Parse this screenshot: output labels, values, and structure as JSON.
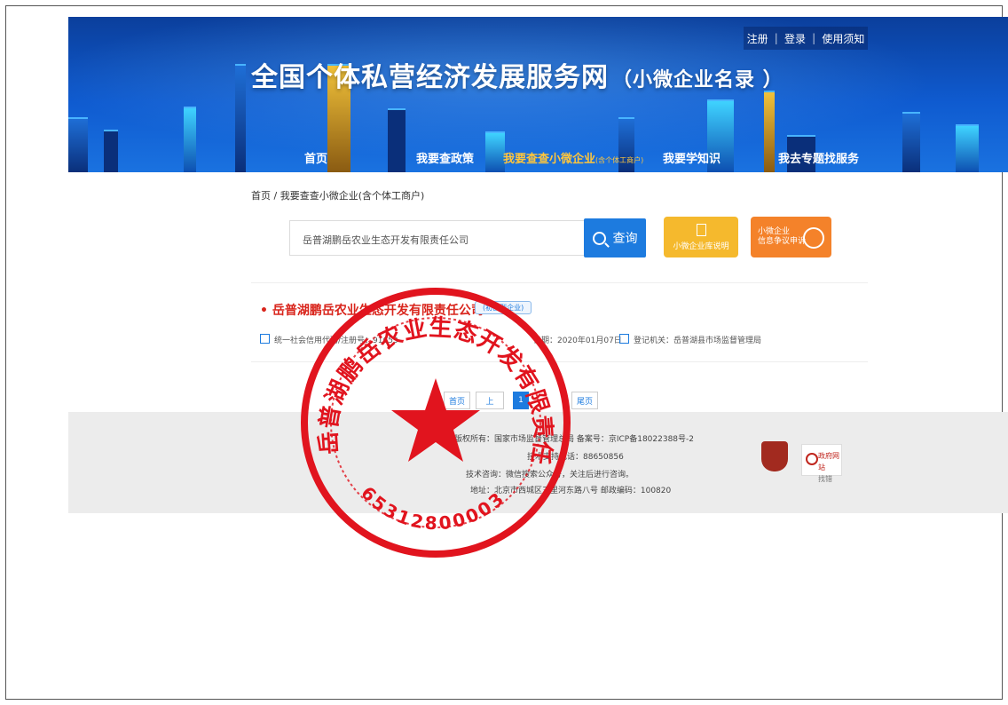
{
  "header": {
    "title": "全国个体私营经济发展服务网",
    "subtitle": "（小微企业名录 ）",
    "top_links": [
      "注册",
      "登录",
      "使用须知"
    ]
  },
  "nav": {
    "items": [
      {
        "label": "首页",
        "small": ""
      },
      {
        "label": "我要查政策",
        "small": ""
      },
      {
        "label": "我要查查小微企业",
        "small": "(含个体工商户)"
      },
      {
        "label": "我要学知识",
        "small": ""
      },
      {
        "label": "我去专题找服务",
        "small": ""
      }
    ],
    "active_index": 2
  },
  "breadcrumb": "首页 / 我要查查小微企业(含个体工商户)",
  "search": {
    "value": "岳普湖鹏岳农业生态开发有限责任公司",
    "button_label": "查询"
  },
  "tiles": {
    "library_label": "小微企业库说明",
    "appeal_line1": "小微企业",
    "appeal_line2": "信息争议申诉"
  },
  "result": {
    "company_name": "岳普湖鹏岳农业生态开发有限责任公司",
    "badge": "(初创型企业)",
    "credit_code": "统一社会信用代码/注册号：91653",
    "date": "日期：2020年01月07日",
    "registration_authority": "登记机关：岳普湖县市场监督管理局"
  },
  "pagination": {
    "first": "首页",
    "prev": "上",
    "current": "1",
    "last": "尾页"
  },
  "footer": {
    "copyright": "版权所有：国家市场监督管理总局 备案号：京ICP备18022388号-2",
    "phone": "技术支持电话：88650856",
    "consult": "技术咨询：微信搜索公众号，关注后进行咨询。",
    "address": "地址：北京市西城区三里河东路八号 邮政编码：100820",
    "gov_site_line1": "政府网站",
    "gov_site_line2": "找错"
  },
  "seal": {
    "text": "岳普湖鹏岳农业生态开发有限责任公司",
    "number": "653128000031"
  },
  "colors": {
    "banner": "#0f5bd0",
    "accent_blue": "#1d7bdf",
    "seal_red": "#e1141e",
    "nav_active": "#ffc63c"
  }
}
